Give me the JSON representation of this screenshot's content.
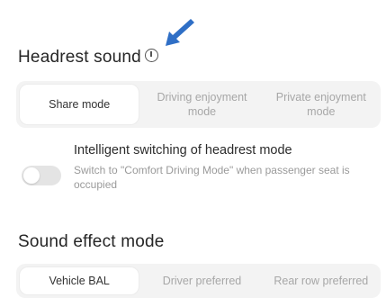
{
  "headrest": {
    "title": "Headrest sound",
    "modes": [
      {
        "label": "Share mode",
        "active": true
      },
      {
        "label": "Driving enjoyment mode",
        "active": false
      },
      {
        "label": "Private enjoyment mode",
        "active": false
      }
    ]
  },
  "intelligent_switch": {
    "title": "Intelligent switching of headrest mode",
    "description": "Switch to \"Comfort Driving Mode\" when passenger seat is occupied",
    "enabled": false
  },
  "sound_effect": {
    "title": "Sound effect mode",
    "modes": [
      {
        "label": "Vehicle BAL",
        "active": true
      },
      {
        "label": "Driver preferred",
        "active": false
      },
      {
        "label": "Rear row preferred",
        "active": false
      }
    ]
  },
  "colors": {
    "arrow": "#2f6fc6",
    "segment_bg": "#f3f3f3",
    "inactive_text": "#a7a7a7"
  }
}
